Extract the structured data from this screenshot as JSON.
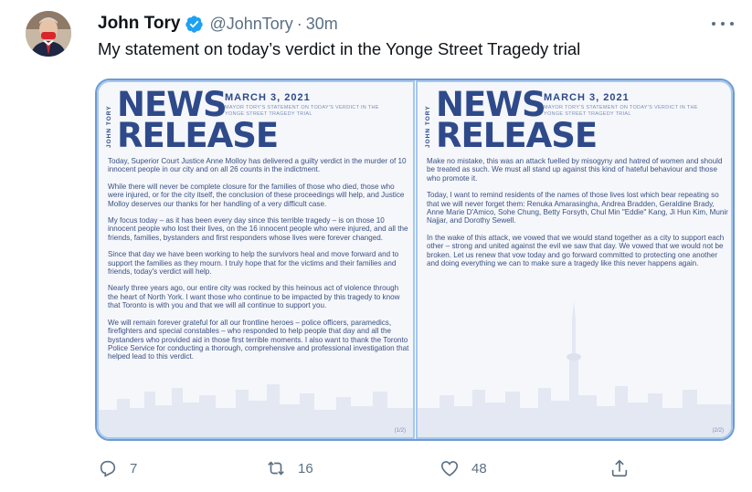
{
  "author": {
    "name": "John Tory",
    "handle": "@JohnTory",
    "separator": "·",
    "time": "30m"
  },
  "tweet_text": "My statement on today’s verdict in the Yonge Street Tragedy trial",
  "release": {
    "side_label": "JOHN TORY",
    "word1": "NEWS",
    "word2": "RELEASE",
    "date": "MARCH 3, 2021",
    "subtitle": "MAYOR TORY'S STATEMENT ON TODAY'S VERDICT IN THE YONGE STREET TRAGEDY TRIAL",
    "page1": {
      "paragraphs": [
        "Today, Superior Court Justice Anne Molloy has delivered a guilty verdict in the murder of 10 innocent people in our city and on all 26 counts in the indictment.",
        "While there will never be complete closure for the families of those who died, those who were injured, or for the city itself, the conclusion of these proceedings will help, and Justice Molloy deserves our thanks for her handling of a very difficult case.",
        "My focus today – as it has been every day since this terrible tragedy – is on those 10 innocent people who lost their lives, on the 16 innocent people who were injured, and all the friends, families, bystanders and first responders whose lives were forever changed.",
        "Since that day we have been working to help the survivors heal and move forward and to support the families as they mourn. I truly hope that for the victims and their families and friends, today's verdict will help.",
        "Nearly three years ago, our entire city was rocked by this heinous act of violence through the heart of North York. I want those who continue to be impacted by this tragedy to know that Toronto is with you and that we will all continue to support you.",
        "We will remain forever grateful for all our frontline heroes – police officers, paramedics, firefighters and special constables – who responded to help people that day and all the bystanders who provided aid in those first terrible moments. I also want to thank the Toronto Police Service for conducting a thorough, comprehensive and professional investigation that helped lead to this verdict."
      ],
      "page_number": "(1/2)"
    },
    "page2": {
      "paragraphs": [
        "Make no mistake, this was an attack fuelled by misogyny and hatred of women and should be treated as such. We must all stand up against this kind of hateful behaviour and those who promote it.",
        "Today, I want to remind residents of the names of those lives lost which bear repeating so that we will never forget them: Renuka Amarasingha, Andrea Bradden, Geraldine Brady, Anne Marie D'Amico, Sohe Chung, Betty Forsyth, Chul Min \"Eddie\" Kang, Ji Hun Kim, Munir Najjar, and Dorothy Sewell.",
        "In the wake of this attack, we vowed that we would stand together as a city to support each other – strong and united against the evil we saw that day. We vowed that we would not be broken. Let us renew that vow today and go forward committed to protecting one another and doing everything we can to make sure a tragedy like this never happens again."
      ],
      "page_number": "(2/2)"
    }
  },
  "actions": {
    "replies": "7",
    "retweets": "16",
    "likes": "48"
  },
  "icons": {
    "verified": "verified-badge-icon",
    "more": "more-icon",
    "reply": "reply-icon",
    "retweet": "retweet-icon",
    "like": "heart-icon",
    "share": "share-icon"
  },
  "colors": {
    "verified_blue": "#1da1f2",
    "secondary_text": "#5b7083",
    "release_navy": "#2e4a8a",
    "media_border": "#6f9ad1"
  }
}
